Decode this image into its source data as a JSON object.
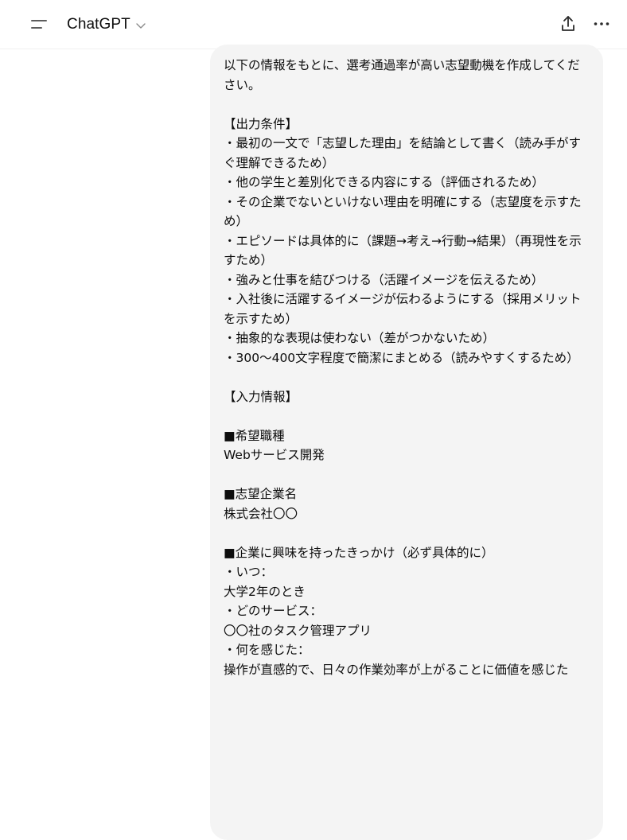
{
  "header": {
    "model_name": "ChatGPT",
    "icons": {
      "menu": "sidebar-menu-icon",
      "model_dropdown": "chevron-down-icon",
      "share": "share-icon",
      "more": "more-dots-icon"
    }
  },
  "message": {
    "role": "user",
    "text": "以下の情報をもとに、選考通過率が高い志望動機を作成してください。\n\n【出力条件】\n・最初の一文で「志望した理由」を結論として書く（読み手がすぐ理解できるため）\n・他の学生と差別化できる内容にする（評価されるため）\n・その企業でないといけない理由を明確にする（志望度を示すため）\n・エピソードは具体的に（課題→考え→行動→結果）（再現性を示すため）\n・強みと仕事を結びつける（活躍イメージを伝えるため）\n・入社後に活躍するイメージが伝わるようにする（採用メリットを示すため）\n・抽象的な表現は使わない（差がつかないため）\n・300〜400文字程度で簡潔にまとめる（読みやすくするため）\n\n【入力情報】\n\n■希望職種\nWebサービス開発\n\n■志望企業名\n株式会社〇〇\n\n■企業に興味を持ったきっかけ（必ず具体的に）\n・いつ：\n大学2年のとき\n・どのサービス：\n〇〇社のタスク管理アプリ\n・何を感じた：\n操作が直感的で、日々の作業効率が上がることに価値を感じた"
  },
  "colors": {
    "background": "#ffffff",
    "bubble": "#f4f4f4",
    "text": "#0d0d0d",
    "icon": "#5d5d5d"
  }
}
